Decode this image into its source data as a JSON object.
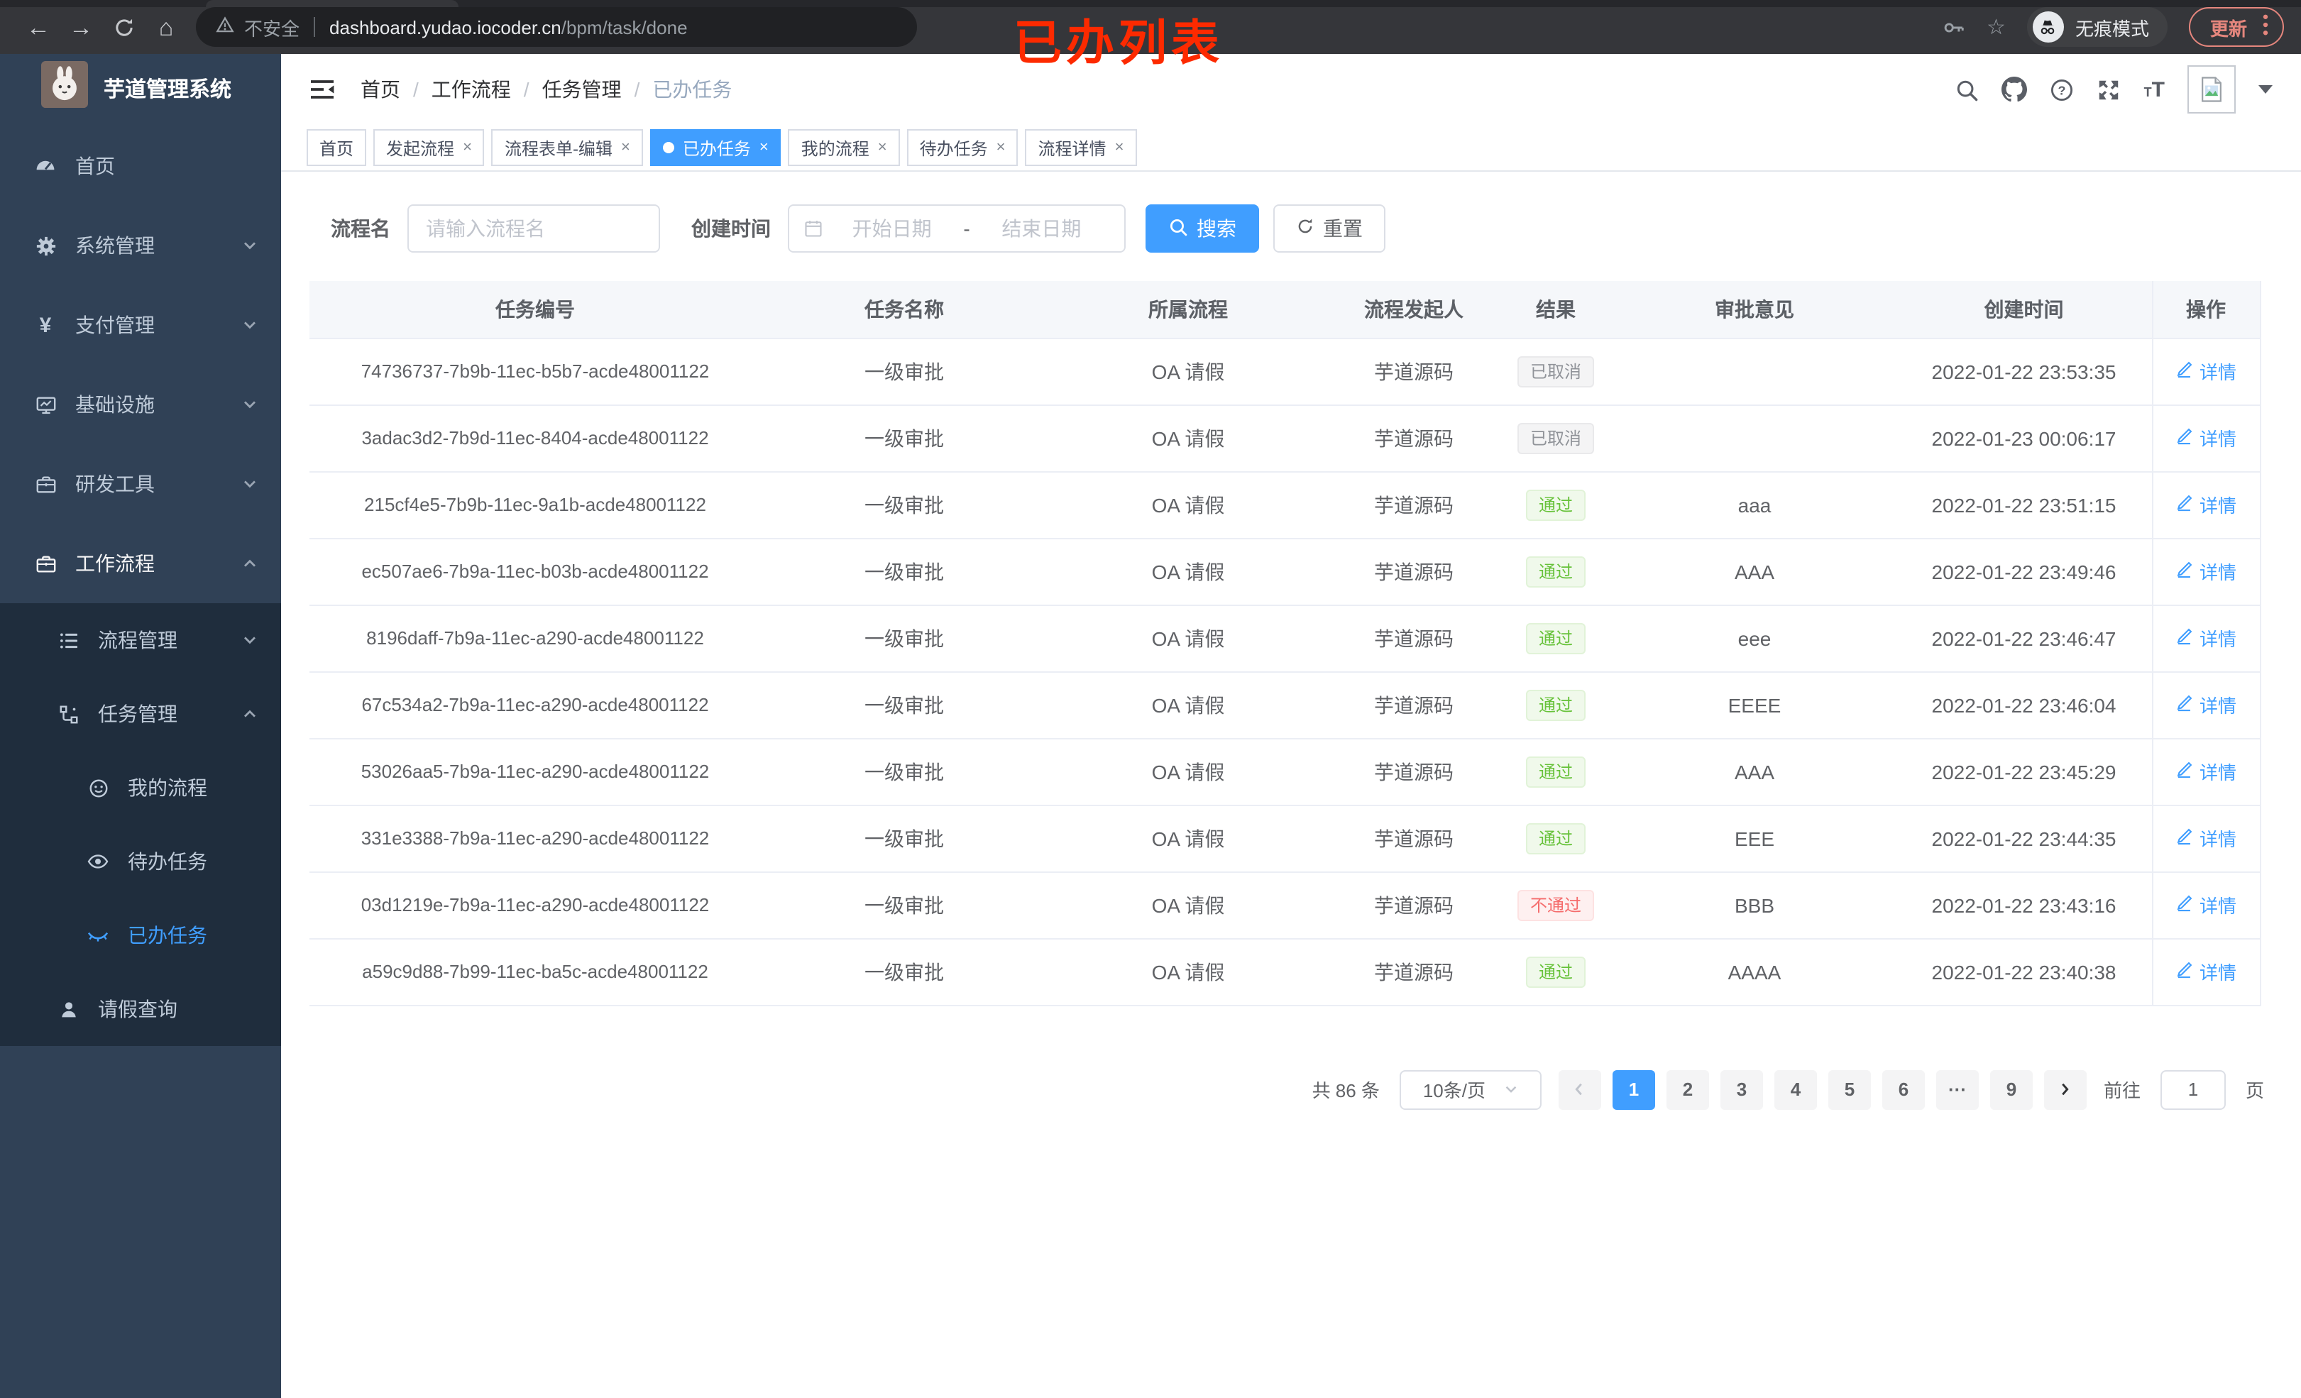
{
  "colors": {
    "accent": "#409eff",
    "success": "#67c23a",
    "danger": "#f56c6c",
    "info": "#909399",
    "annotation": "#fd2a00",
    "sidebar_bg": "#304156",
    "submenu_bg": "#1f2d3d"
  },
  "annotation": {
    "text": "已办列表"
  },
  "browser": {
    "security_label": "不安全",
    "url_domain": "dashboard.yudao.iocoder.cn",
    "url_path": "/bpm/task/done",
    "incognito_label": "无痕模式",
    "update_label": "更新"
  },
  "sidebar": {
    "app_title": "芋道管理系统",
    "items": [
      {
        "key": "home",
        "label": "首页",
        "icon": "gauge",
        "level": 1
      },
      {
        "key": "system",
        "label": "系统管理",
        "icon": "gear",
        "level": 1,
        "chevron": "down"
      },
      {
        "key": "payment",
        "label": "支付管理",
        "icon": "yen",
        "level": 1,
        "chevron": "down"
      },
      {
        "key": "infra",
        "label": "基础设施",
        "icon": "monitor",
        "level": 1,
        "chevron": "down"
      },
      {
        "key": "devtools",
        "label": "研发工具",
        "icon": "briefcase",
        "level": 1,
        "chevron": "down"
      },
      {
        "key": "workflow",
        "label": "工作流程",
        "icon": "briefcase",
        "level": 1,
        "chevron": "up",
        "open": true
      },
      {
        "key": "process-mgmt",
        "label": "流程管理",
        "icon": "list",
        "level": 2,
        "chevron": "down",
        "sub": true
      },
      {
        "key": "task-mgmt",
        "label": "任务管理",
        "icon": "tree",
        "level": 2,
        "chevron": "up",
        "sub": true
      },
      {
        "key": "my-process",
        "label": "我的流程",
        "icon": "face",
        "level": 3,
        "sub": true
      },
      {
        "key": "todo-tasks",
        "label": "待办任务",
        "icon": "eye",
        "level": 3,
        "sub": true
      },
      {
        "key": "done-tasks",
        "label": "已办任务",
        "icon": "eye-closed",
        "level": 3,
        "sub": true,
        "active": true
      },
      {
        "key": "leave-query",
        "label": "请假查询",
        "icon": "person",
        "level": 2,
        "sub": true
      }
    ]
  },
  "navbar": {
    "breadcrumb": [
      "首页",
      "工作流程",
      "任务管理",
      "已办任务"
    ]
  },
  "tags": [
    {
      "key": "home",
      "label": "首页"
    },
    {
      "key": "start-process",
      "label": "发起流程",
      "closable": true
    },
    {
      "key": "process-form-edit",
      "label": "流程表单-编辑",
      "closable": true
    },
    {
      "key": "done-tasks",
      "label": "已办任务",
      "closable": true,
      "active": true
    },
    {
      "key": "my-process",
      "label": "我的流程",
      "closable": true
    },
    {
      "key": "todo-tasks",
      "label": "待办任务",
      "closable": true
    },
    {
      "key": "process-detail",
      "label": "流程详情",
      "closable": true
    }
  ],
  "filter": {
    "name_label": "流程名",
    "name_placeholder": "请输入流程名",
    "time_label": "创建时间",
    "start_placeholder": "开始日期",
    "range_separator": "-",
    "end_placeholder": "结束日期",
    "search_label": "搜索",
    "reset_label": "重置"
  },
  "table": {
    "columns": [
      "任务编号",
      "任务名称",
      "所属流程",
      "流程发起人",
      "结果",
      "审批意见",
      "创建时间",
      "操作"
    ],
    "action_label": "详情",
    "rows": [
      {
        "id": "74736737-7b9b-11ec-b5b7-acde48001122",
        "name": "一级审批",
        "process": "OA 请假",
        "starter": "芋道源码",
        "result": "已取消",
        "result_type": "info",
        "comment": "",
        "created": "2022-01-22 23:53:35"
      },
      {
        "id": "3adac3d2-7b9d-11ec-8404-acde48001122",
        "name": "一级审批",
        "process": "OA 请假",
        "starter": "芋道源码",
        "result": "已取消",
        "result_type": "info",
        "comment": "",
        "created": "2022-01-23 00:06:17"
      },
      {
        "id": "215cf4e5-7b9b-11ec-9a1b-acde48001122",
        "name": "一级审批",
        "process": "OA 请假",
        "starter": "芋道源码",
        "result": "通过",
        "result_type": "success",
        "comment": "aaa",
        "created": "2022-01-22 23:51:15"
      },
      {
        "id": "ec507ae6-7b9a-11ec-b03b-acde48001122",
        "name": "一级审批",
        "process": "OA 请假",
        "starter": "芋道源码",
        "result": "通过",
        "result_type": "success",
        "comment": "AAA",
        "created": "2022-01-22 23:49:46"
      },
      {
        "id": "8196daff-7b9a-11ec-a290-acde48001122",
        "name": "一级审批",
        "process": "OA 请假",
        "starter": "芋道源码",
        "result": "通过",
        "result_type": "success",
        "comment": "eee",
        "created": "2022-01-22 23:46:47"
      },
      {
        "id": "67c534a2-7b9a-11ec-a290-acde48001122",
        "name": "一级审批",
        "process": "OA 请假",
        "starter": "芋道源码",
        "result": "通过",
        "result_type": "success",
        "comment": "EEEE",
        "created": "2022-01-22 23:46:04"
      },
      {
        "id": "53026aa5-7b9a-11ec-a290-acde48001122",
        "name": "一级审批",
        "process": "OA 请假",
        "starter": "芋道源码",
        "result": "通过",
        "result_type": "success",
        "comment": "AAA",
        "created": "2022-01-22 23:45:29"
      },
      {
        "id": "331e3388-7b9a-11ec-a290-acde48001122",
        "name": "一级审批",
        "process": "OA 请假",
        "starter": "芋道源码",
        "result": "通过",
        "result_type": "success",
        "comment": "EEE",
        "created": "2022-01-22 23:44:35"
      },
      {
        "id": "03d1219e-7b9a-11ec-a290-acde48001122",
        "name": "一级审批",
        "process": "OA 请假",
        "starter": "芋道源码",
        "result": "不通过",
        "result_type": "danger",
        "comment": "BBB",
        "created": "2022-01-22 23:43:16"
      },
      {
        "id": "a59c9d88-7b99-11ec-ba5c-acde48001122",
        "name": "一级审批",
        "process": "OA 请假",
        "starter": "芋道源码",
        "result": "通过",
        "result_type": "success",
        "comment": "AAAA",
        "created": "2022-01-22 23:40:38"
      }
    ]
  },
  "pagination": {
    "total_label": "共 86 条",
    "page_size": "10条/页",
    "pages": [
      "1",
      "2",
      "3",
      "4",
      "5",
      "6",
      "···",
      "9"
    ],
    "active_page": "1",
    "goto_label": "前往",
    "goto_value": "1",
    "goto_suffix": "页"
  }
}
